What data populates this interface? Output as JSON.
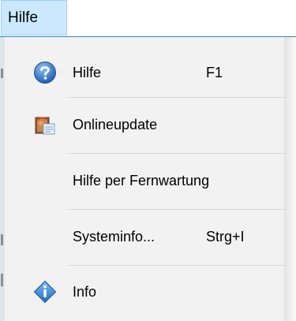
{
  "menubar": {
    "title": "Hilfe"
  },
  "menu": {
    "items": [
      {
        "label": "Hilfe",
        "shortcut": "F1",
        "icon": "help-icon"
      },
      {
        "label": "Onlineupdate",
        "shortcut": "",
        "icon": "online-update-icon"
      },
      {
        "label": "Hilfe per Fernwartung",
        "shortcut": "",
        "icon": ""
      },
      {
        "label": "Systeminfo...",
        "shortcut": "Strg+I",
        "icon": ""
      },
      {
        "label": "Info",
        "shortcut": "",
        "icon": "info-icon"
      }
    ]
  },
  "colors": {
    "menu_title_bg": "#cce8ff",
    "menu_title_border": "#99d1ff",
    "menubar_line": "#2e86c8",
    "dropdown_bg": "#f2f2f2",
    "separator": "#d7d7d7",
    "help_icon_blue": "#1f5fb3",
    "info_icon_blue": "#1f6fc4"
  }
}
